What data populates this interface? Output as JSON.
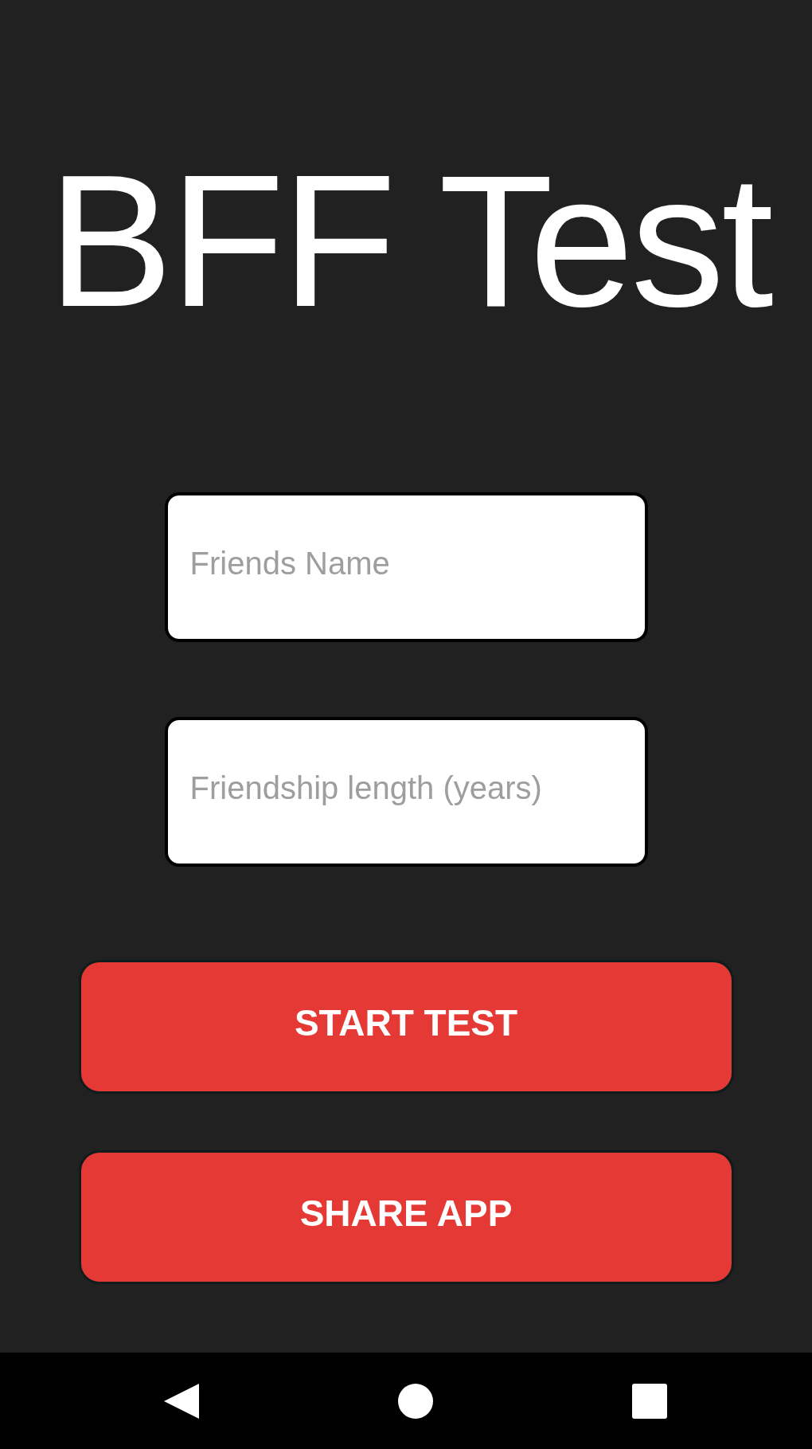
{
  "title": "BFF Test",
  "fields": [
    {
      "placeholder": "Friends Name"
    },
    {
      "placeholder": "Friendship length (years)"
    }
  ],
  "buttons": [
    {
      "label": "START TEST"
    },
    {
      "label": "SHARE APP"
    }
  ],
  "nav_bar": {
    "buttons": [
      {
        "kind": "back"
      },
      {
        "kind": "home"
      },
      {
        "kind": "recents"
      }
    ]
  }
}
